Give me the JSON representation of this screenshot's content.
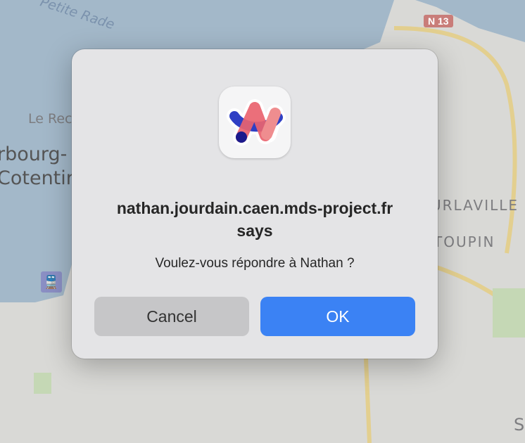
{
  "map": {
    "labels": [
      "Petite Rade",
      "Le Rec",
      "rbourg-",
      "Cotentin",
      "URLAVILLE",
      "TOUPIN",
      "S"
    ],
    "road_badge": "N 13",
    "train_icon": "train-station-icon"
  },
  "dialog": {
    "app_icon": "arc-browser-icon",
    "title": "nathan.jourdain.caen.mds-project.fr says",
    "message": "Voulez-vous répondre à Nathan ?",
    "cancel_label": "Cancel",
    "ok_label": "OK"
  },
  "colors": {
    "accent": "#3b82f4",
    "water": "#a3b8c9",
    "land": "#d9d9d6"
  }
}
